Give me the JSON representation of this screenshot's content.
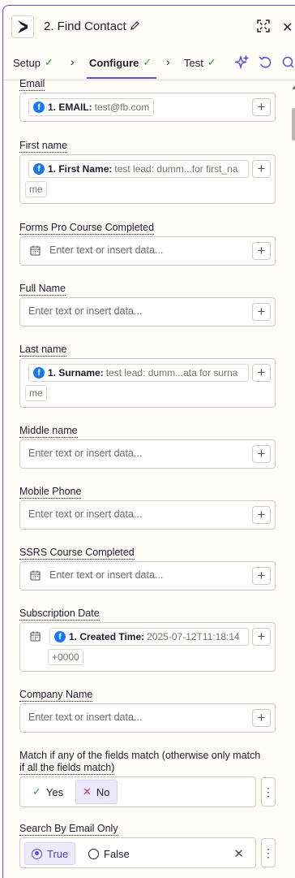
{
  "header": {
    "step_title": "2. Find Contact",
    "icons": [
      "dynamics-app-icon",
      "pencil-icon",
      "expand-icon",
      "close-icon"
    ]
  },
  "tabs": [
    {
      "label": "Setup",
      "status": "complete"
    },
    {
      "label": "Configure",
      "status": "complete",
      "active": true
    },
    {
      "label": "Test",
      "status": "complete"
    }
  ],
  "fields": {
    "email": {
      "label": "Email",
      "pill_bold": "1. EMAIL:",
      "pill_value": "test@fb.com"
    },
    "first_name": {
      "label": "First name",
      "pill_bold": "1. First Name:",
      "pill_value": "test lead: dumm...for first_na",
      "wrap": "me"
    },
    "forms_pro": {
      "label": "Forms Pro Course Completed",
      "placeholder": "Enter text or insert data..."
    },
    "full_name": {
      "label": "Full Name",
      "placeholder": "Enter text or insert data..."
    },
    "last_name": {
      "label": "Last name",
      "pill_bold": "1. Surname:",
      "pill_value": "test lead: dumm...ata for surna",
      "wrap": "me"
    },
    "middle_name": {
      "label": "Middle name",
      "placeholder": "Enter text or insert data..."
    },
    "mobile_phone": {
      "label": "Mobile Phone",
      "placeholder": "Enter text or insert data..."
    },
    "ssrs": {
      "label": "SSRS Course Completed",
      "placeholder": "Enter text or insert data..."
    },
    "subscription_date": {
      "label": "Subscription Date",
      "pill_bold": "1. Created Time:",
      "pill_value": "2025-07-12T11:18:14",
      "wrap": "+0000"
    },
    "company_name": {
      "label": "Company Name",
      "placeholder": "Enter text or insert data..."
    },
    "match_any": {
      "label_line1": "Match if any of the fields match (otherwise only match",
      "label_line2": "if all the fields match)",
      "yes": "Yes",
      "no": "No",
      "selected": "No"
    },
    "search_email_only": {
      "label": "Search By Email Only",
      "true": "True",
      "false": "False",
      "selected": "True"
    }
  },
  "colors": {
    "accent": "#5b4bdb",
    "check": "#2f9e44",
    "facebook": "#1877f2"
  }
}
